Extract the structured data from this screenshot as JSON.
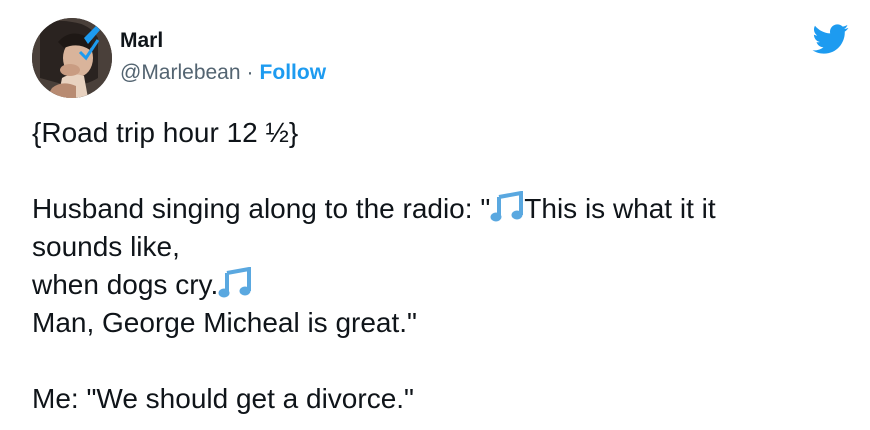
{
  "user": {
    "display_name": "Marl",
    "handle": "@Marlebean",
    "separator": "·",
    "follow_label": "Follow"
  },
  "icons": {
    "brand": "twitter-bird-icon",
    "emoji": "musical-notes-icon"
  },
  "colors": {
    "link": "#1d9bf0",
    "text": "#0f1419",
    "secondary": "#536471",
    "emoji": "#5aa8e0"
  },
  "tweet": {
    "line1": "{Road trip hour 12 ½}",
    "line2a": "Husband singing along to the radio: \"",
    "line2b": "This is what it it",
    "line3": "sounds like,",
    "line4": "when dogs cry.",
    "line5": "Man, George Micheal is great.\"",
    "line6": "Me: \"We should get a divorce.\""
  }
}
